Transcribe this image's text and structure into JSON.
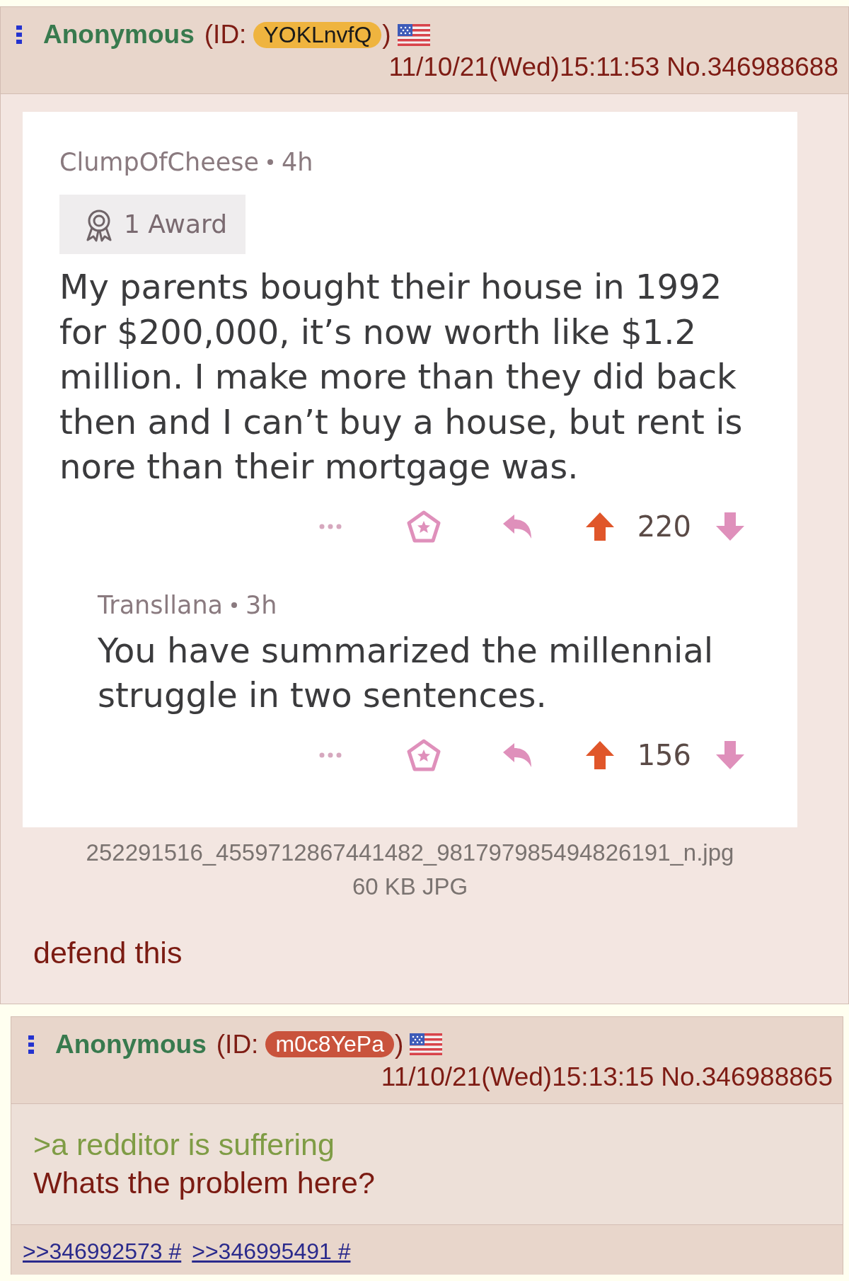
{
  "posts": [
    {
      "kind": "op",
      "name": "Anonymous",
      "id_label": "(ID:",
      "id_badge": {
        "text": "YOKLnvfQ",
        "color": "#efb43f"
      },
      "id_close": ")",
      "date": "11/10/21(Wed)15:11:53",
      "number": "No.346988688",
      "attachment": {
        "comments": [
          {
            "author": "ClumpOfCheese",
            "age": "4h",
            "award": "1 Award",
            "text": "My parents bought their house in 1992 for $200,000, it’s now worth like $1.2 million. I make more than they did back then and I can’t buy a house, but rent is nore than their mortgage was.",
            "score": "220",
            "upvoted": true,
            "children": [
              {
                "author": "Transllana",
                "age": "3h",
                "text": "You have summarized the millennial struggle in two sentences.",
                "score": "156",
                "upvoted": true
              }
            ]
          }
        ],
        "filename": "252291516_4559712867441482_981797985494826191_n.jpg",
        "fileinfo": "60 KB JPG"
      },
      "message": [
        {
          "kind": "text",
          "text": "defend this"
        }
      ]
    },
    {
      "kind": "reply",
      "name": "Anonymous",
      "id_label": "(ID:",
      "id_badge": {
        "text": "m0c8YePa",
        "color": "#c9533c"
      },
      "id_close": ")",
      "date": "11/10/21(Wed)15:13:15",
      "number": "No.346988865",
      "message": [
        {
          "kind": "quote",
          "text": ">a redditor is suffering"
        },
        {
          "kind": "text",
          "text": "Whats the problem here?"
        }
      ],
      "backlinks": [
        ">>346992573 #",
        ">>346995491 #"
      ]
    }
  ]
}
